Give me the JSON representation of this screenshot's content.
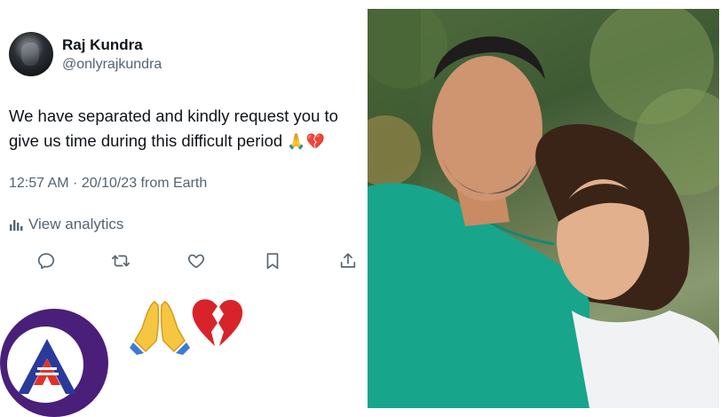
{
  "tweet": {
    "author_name": "Raj Kundra",
    "handle": "@onlyrajkundra",
    "text": "We have separated and kindly request you to give us time during this difficult period",
    "text_emojis": "🙏💔",
    "meta": "12:57 AM · 20/10/23 from Earth",
    "analytics_label": "View analytics",
    "actions": [
      "reply-icon",
      "retweet-icon",
      "like-icon",
      "bookmark-icon",
      "share-icon"
    ]
  },
  "big_emojis": {
    "pray": "🙏",
    "broken_heart": "💔"
  },
  "colors": {
    "text_primary": "#0f1419",
    "text_secondary": "#536471",
    "logo_purple": "#4a1f7a",
    "logo_blue": "#2a3a9a",
    "logo_red": "#e0322b",
    "shirt_green": "#17a58c"
  }
}
